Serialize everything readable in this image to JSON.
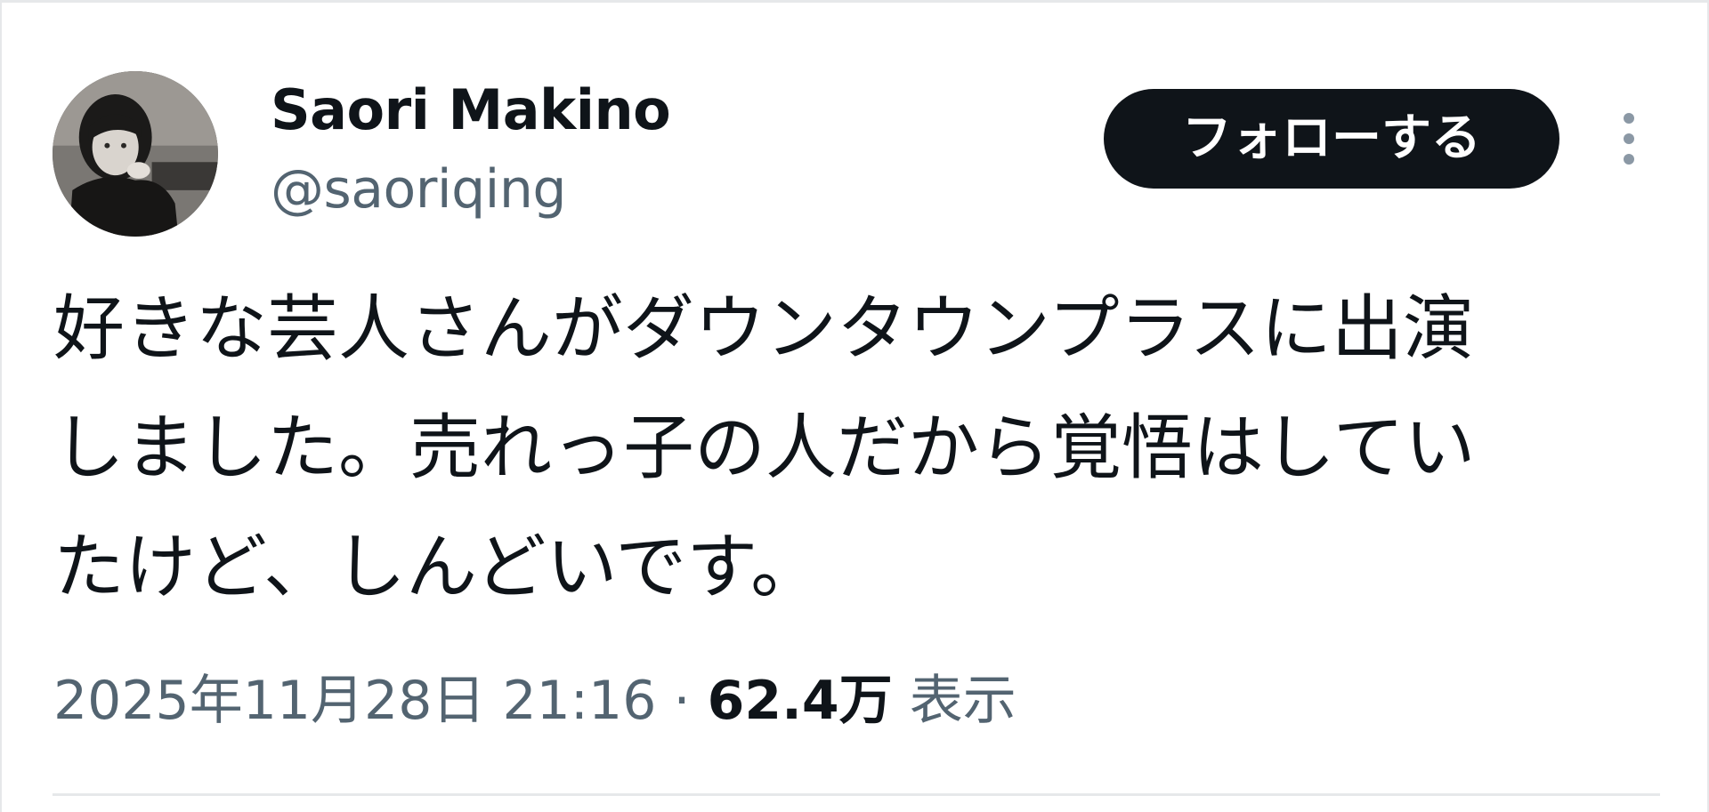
{
  "author": {
    "display_name": "Saori Makino",
    "handle": "@saoriqing"
  },
  "actions": {
    "follow_label": "フォローする",
    "more_icon": "more-vertical-icon"
  },
  "tweet": {
    "lines": [
      "好きな芸人さんがダウンタウンプラスに出演",
      "しました。売れっ子の人だから覚悟はしてい",
      "たけど、しんどいです。"
    ]
  },
  "meta": {
    "timestamp": "2025年11月28日 21:16",
    "separator": "·",
    "views_count": "62.4万",
    "views_label": "表示"
  },
  "colors": {
    "text_primary": "#0f1419",
    "text_secondary": "#536471",
    "button_bg": "#0f1419",
    "button_text": "#ffffff",
    "border": "#e6e8ea"
  }
}
